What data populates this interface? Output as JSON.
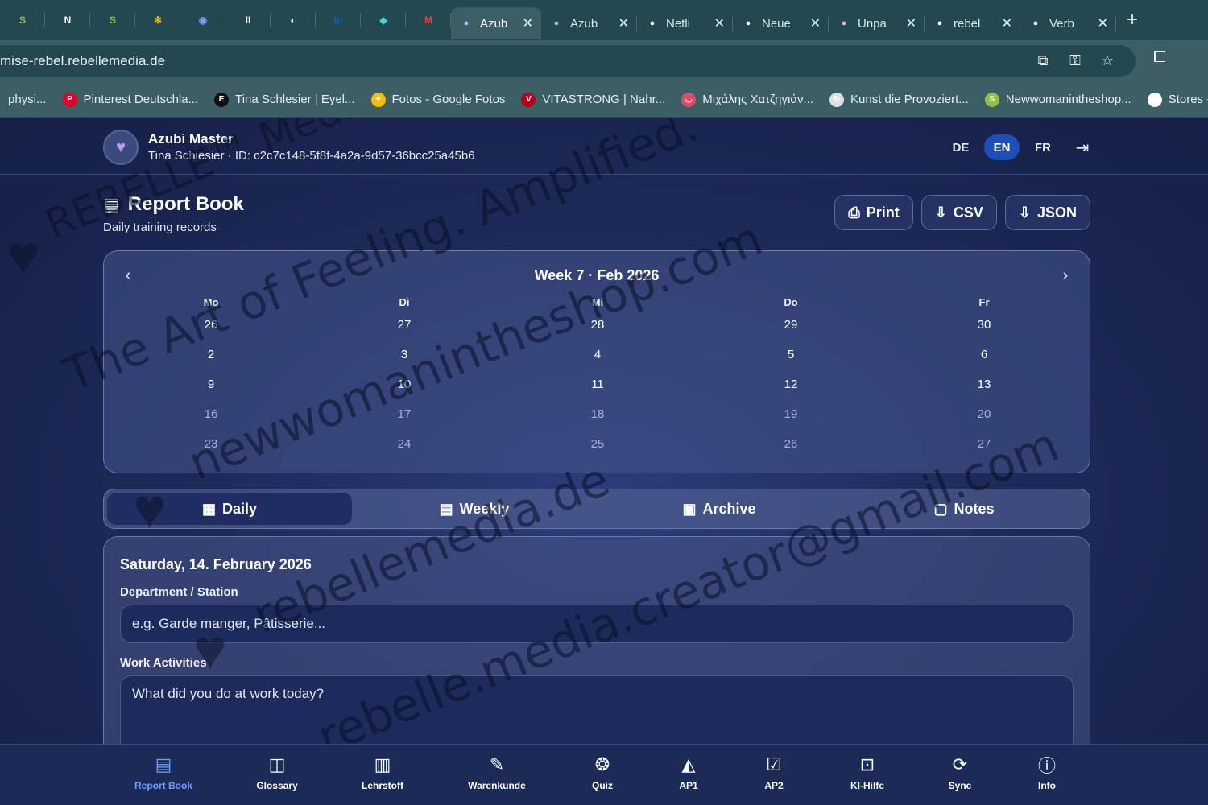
{
  "browser": {
    "pinned_tabs": [
      {
        "icon": "shopify-icon",
        "glyph": "S",
        "color": "#95bf47"
      },
      {
        "icon": "notion-icon",
        "glyph": "N",
        "color": "#ffffff"
      },
      {
        "icon": "shopify-icon",
        "glyph": "S",
        "color": "#95bf47"
      },
      {
        "icon": "pinwheel-icon",
        "glyph": "✻",
        "color": "#f4b400"
      },
      {
        "icon": "circle-app-icon",
        "glyph": "◉",
        "color": "#7b9cff"
      },
      {
        "icon": "pause-app-icon",
        "glyph": "II",
        "color": "#ffffff"
      },
      {
        "icon": "github-icon",
        "glyph": "◐",
        "color": "#ffffff"
      },
      {
        "icon": "linkedin-icon",
        "glyph": "in",
        "color": "#0a66c2"
      },
      {
        "icon": "diamond-app-icon",
        "glyph": "◆",
        "color": "#37e0d0"
      },
      {
        "icon": "gmail-icon",
        "glyph": "M",
        "color": "#ea4335"
      }
    ],
    "tabs": [
      {
        "title": "Azub",
        "icon": "bubble-icon",
        "color": "#9ec5ff",
        "active": true
      },
      {
        "title": "Azub",
        "icon": "bubble-icon",
        "color": "#9ec5ff",
        "active": false
      },
      {
        "title": "Netli",
        "icon": "openai-icon",
        "color": "#ffffff",
        "active": false
      },
      {
        "title": "Neue",
        "icon": "image-icon",
        "color": "#ffffff",
        "active": false
      },
      {
        "title": "Unpa",
        "icon": "cloud-icon",
        "color": "#f7a8ff",
        "active": false
      },
      {
        "title": "rebel",
        "icon": "github-icon",
        "color": "#ffffff",
        "active": false
      },
      {
        "title": "Verb",
        "icon": "github-icon",
        "color": "#ffffff",
        "active": false
      }
    ],
    "close_glyph": "✕",
    "new_tab_glyph": "+",
    "url": "mise-rebel.rebellemedia.de",
    "bookmarks": [
      {
        "label": "physi...",
        "icon": "none",
        "color": "transparent"
      },
      {
        "label": "Pinterest Deutschla...",
        "icon": "pinterest-icon",
        "glyph": "P",
        "color": "#e60023"
      },
      {
        "label": "Tina Schlesier | Eyel...",
        "icon": "e-icon",
        "glyph": "E",
        "color": "#111111"
      },
      {
        "label": "Fotos - Google Fotos",
        "icon": "google-photos-icon",
        "glyph": "✦",
        "color": "#fbbc04"
      },
      {
        "label": "VITASTRONG | Nahr...",
        "icon": "vitastrong-icon",
        "glyph": "V",
        "color": "#b3001b"
      },
      {
        "label": "Μιχάλης Χατζηγιάν...",
        "icon": "lips-icon",
        "glyph": "◡",
        "color": "#d94f6b"
      },
      {
        "label": "Kunst die Provoziert...",
        "icon": "circle-arrow-icon",
        "glyph": "↻",
        "color": "#e0e0e0"
      },
      {
        "label": "Newwomanintheshop...",
        "icon": "shopify-icon",
        "glyph": "S",
        "color": "#95bf47"
      },
      {
        "label": "Stores - Mein",
        "icon": "stores-icon",
        "glyph": "◈",
        "color": "#ffffff"
      }
    ]
  },
  "app": {
    "brand": "Azubi Master",
    "user_line": "Tina Schlesier · ID: c2c7c148-5f8f-4a2a-9d57-36bcc25a45b6",
    "languages": [
      {
        "code": "DE",
        "active": false
      },
      {
        "code": "EN",
        "active": true
      },
      {
        "code": "FR",
        "active": false
      }
    ],
    "page_title": "Report Book",
    "page_subtitle": "Daily training records",
    "export_buttons": [
      {
        "label": "Print",
        "icon": "printer-icon",
        "glyph": "⎙"
      },
      {
        "label": "CSV",
        "icon": "file-download-icon",
        "glyph": "⇩"
      },
      {
        "label": "JSON",
        "icon": "file-download-icon",
        "glyph": "⇩"
      }
    ],
    "calendar": {
      "title": "Week 7 · Feb 2026",
      "weekdays": [
        "Mo",
        "Di",
        "Mi",
        "Do",
        "Fr"
      ],
      "weeks": [
        [
          {
            "d": "26",
            "dim": false
          },
          {
            "d": "27",
            "dim": false
          },
          {
            "d": "28",
            "dim": false
          },
          {
            "d": "29",
            "dim": false
          },
          {
            "d": "30",
            "dim": false
          }
        ],
        [
          {
            "d": "2",
            "dim": false
          },
          {
            "d": "3",
            "dim": false
          },
          {
            "d": "4",
            "dim": false
          },
          {
            "d": "5",
            "dim": false
          },
          {
            "d": "6",
            "dim": false
          }
        ],
        [
          {
            "d": "9",
            "dim": false
          },
          {
            "d": "10",
            "dim": false
          },
          {
            "d": "11",
            "dim": false
          },
          {
            "d": "12",
            "dim": false
          },
          {
            "d": "13",
            "dim": false
          }
        ],
        [
          {
            "d": "16",
            "dim": true
          },
          {
            "d": "17",
            "dim": true
          },
          {
            "d": "18",
            "dim": true
          },
          {
            "d": "19",
            "dim": true
          },
          {
            "d": "20",
            "dim": true
          }
        ],
        [
          {
            "d": "23",
            "dim": true
          },
          {
            "d": "24",
            "dim": true
          },
          {
            "d": "25",
            "dim": true
          },
          {
            "d": "26",
            "dim": true
          },
          {
            "d": "27",
            "dim": true
          }
        ]
      ]
    },
    "view_tabs": [
      {
        "label": "Daily",
        "icon": "calendar-icon",
        "glyph": "▦",
        "active": true
      },
      {
        "label": "Weekly",
        "icon": "document-icon",
        "glyph": "▤",
        "active": false
      },
      {
        "label": "Archive",
        "icon": "archive-icon",
        "glyph": "▣",
        "active": false
      },
      {
        "label": "Notes",
        "icon": "note-icon",
        "glyph": "▢",
        "active": false
      }
    ],
    "entry": {
      "date": "Saturday, 14. February 2026",
      "department_label": "Department / Station",
      "department_placeholder": "e.g. Garde manger, Pâtisserie...",
      "department_value": "",
      "work_label": "Work Activities",
      "work_placeholder": "What did you do at work today?",
      "work_value": ""
    },
    "bottom_nav": [
      {
        "label": "Report Book",
        "icon": "report-book-icon",
        "glyph": "▤",
        "active": true
      },
      {
        "label": "Glossary",
        "icon": "book-open-icon",
        "glyph": "◫",
        "active": false
      },
      {
        "label": "Lehrstoff",
        "icon": "book-icon",
        "glyph": "▥",
        "active": false
      },
      {
        "label": "Warenkunde",
        "icon": "pen-icon",
        "glyph": "✎",
        "active": false
      },
      {
        "label": "Quiz",
        "icon": "brain-icon",
        "glyph": "❂",
        "active": false
      },
      {
        "label": "AP1",
        "icon": "graduation-cap-icon",
        "glyph": "◭",
        "active": false
      },
      {
        "label": "AP2",
        "icon": "clipboard-check-icon",
        "glyph": "☑",
        "active": false
      },
      {
        "label": "KI-Hilfe",
        "icon": "bot-icon",
        "glyph": "⊡",
        "active": false
      },
      {
        "label": "Sync",
        "icon": "refresh-icon",
        "glyph": "⟳",
        "active": false
      },
      {
        "label": "Info",
        "icon": "info-icon",
        "glyph": "ⓘ",
        "active": false
      }
    ]
  },
  "watermark": {
    "lines": [
      "REBELLE™ Media.",
      "The Art of Feeling. Amplified.",
      "newwomanintheshop.com",
      "rebellemedia.de",
      "rebelle.media.creator@gmail.com"
    ]
  }
}
